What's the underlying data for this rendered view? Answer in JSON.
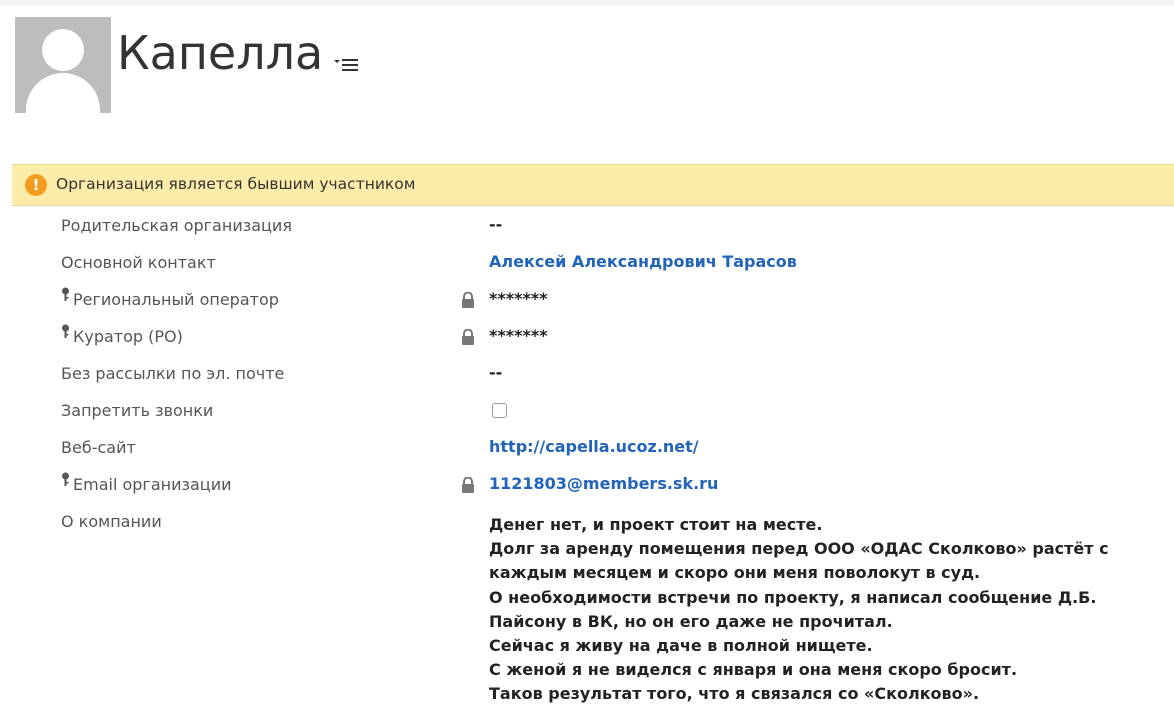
{
  "record": {
    "title": "Капелла"
  },
  "notice": {
    "text": "Организация является бывшим участником",
    "icon": "warning-icon",
    "color": "#fbeda9"
  },
  "fields": {
    "parent": {
      "label": "Родительская организация",
      "value": "--"
    },
    "primary_contact": {
      "label": "Основной контакт",
      "value": "Алексей Александрович Тарасов"
    },
    "regional_operator": {
      "label": "Региональный оператор",
      "value": "*******"
    },
    "curator": {
      "label": "Куратор (РО)",
      "value": "*******"
    },
    "no_email": {
      "label": "Без рассылки по эл. почте",
      "value": "--"
    },
    "no_calls": {
      "label": "Запретить звонки",
      "checked": false
    },
    "website": {
      "label": "Веб-сайт",
      "value": "http://capella.ucoz.net/"
    },
    "email": {
      "label": "Email организации",
      "value": "1121803@members.sk.ru"
    },
    "about": {
      "label": "О компании",
      "lines": [
        "Денег нет, и проект стоит на месте.",
        "Долг за аренду помещения перед ООО «ОДАС Сколково» растёт с",
        "каждым месяцем и скоро они меня поволокут в суд.",
        "О необходимости встречи по проекту, я написал сообщение Д.Б.",
        "Пайсону в ВК, но он его даже не прочитал.",
        "Сейчас я живу на даче в полной нищете.",
        "С женой я не виделся с января и она меня скоро бросит.",
        "Таков результат того, что я связался со «Сколково»."
      ]
    }
  },
  "colors": {
    "link": "#2264b9",
    "warning": "#f39c1f"
  }
}
